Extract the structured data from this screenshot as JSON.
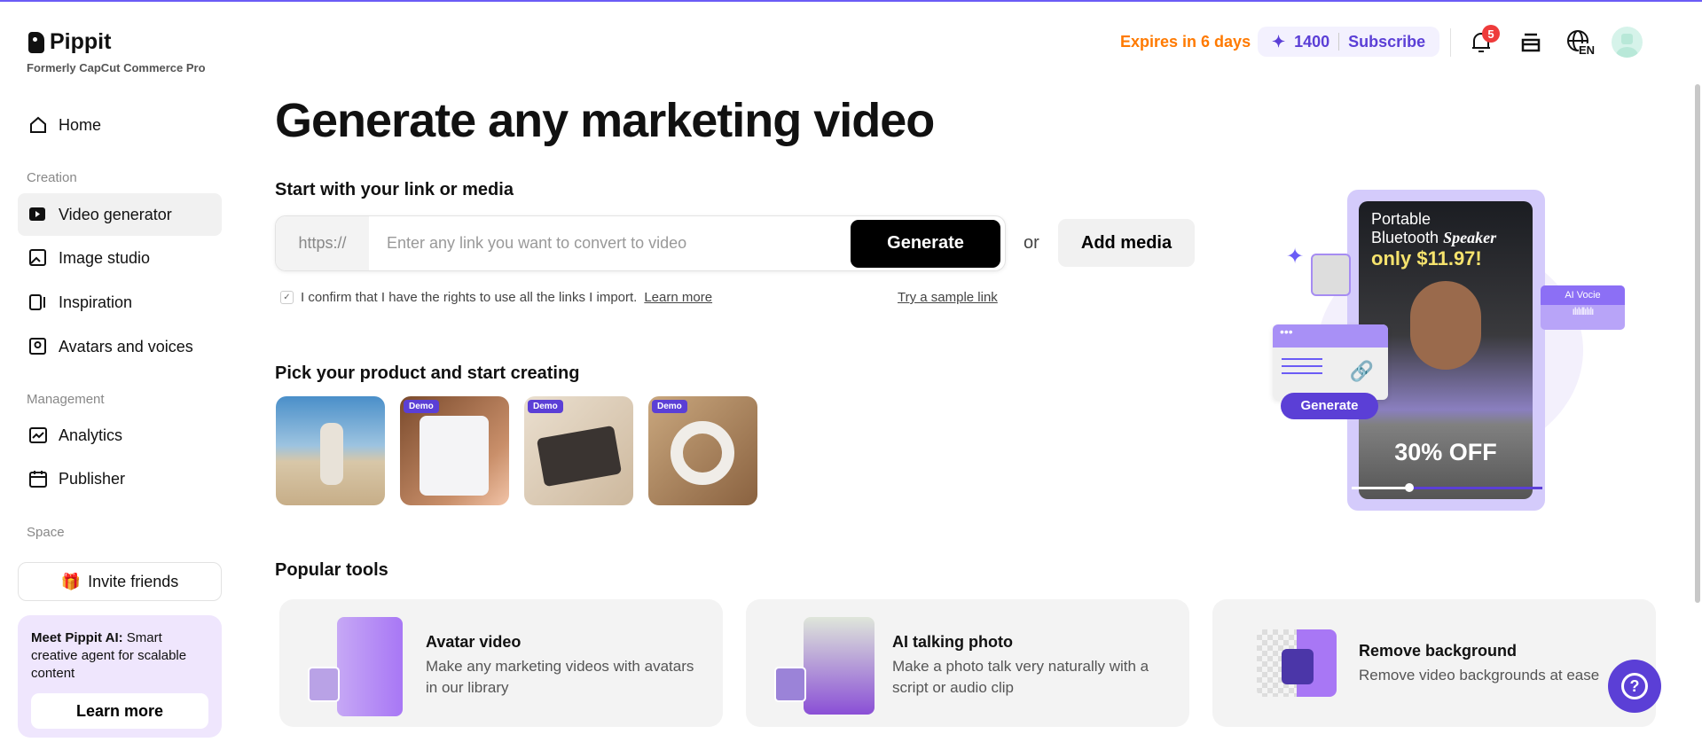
{
  "brand": {
    "name": "Pippit",
    "subtitle": "Formerly CapCut Commerce Pro"
  },
  "header": {
    "expires": "Expires in 6 days",
    "credits": "1400",
    "subscribe": "Subscribe",
    "notifications": "5",
    "language": "EN"
  },
  "sidebar": {
    "home": "Home",
    "creation_label": "Creation",
    "creation": [
      "Video generator",
      "Image studio",
      "Inspiration",
      "Avatars and voices"
    ],
    "management_label": "Management",
    "management": [
      "Analytics",
      "Publisher"
    ],
    "space_label": "Space",
    "invite": "Invite friends",
    "promo": {
      "bold": "Meet Pippit AI:",
      "text": " Smart creative agent for scalable content",
      "button": "Learn more"
    }
  },
  "main": {
    "title": "Generate any marketing video",
    "start_label": "Start with your link or media",
    "protocol": "https://",
    "placeholder": "Enter any link you want to convert to video",
    "generate": "Generate",
    "or": "or",
    "add_media": "Add media",
    "confirm": "I confirm that I have the rights to use all the links I import.",
    "learn_more": "Learn more",
    "sample": "Try a sample link",
    "pick_label": "Pick your product and start creating",
    "demo": "Demo",
    "popular_label": "Popular tools",
    "tools": [
      {
        "title": "Avatar video",
        "desc": "Make any marketing videos with avatars in our library"
      },
      {
        "title": "AI talking photo",
        "desc": "Make a photo talk very naturally with a script or audio clip"
      },
      {
        "title": "Remove background",
        "desc": "Remove video backgrounds at ease"
      }
    ]
  },
  "hero": {
    "line1": "Portable",
    "line2": "Bluetooth",
    "line2b": "Speaker",
    "price": "only $11.97!",
    "discount": "30% OFF",
    "ai_voice": "AI Vocie",
    "generate": "Generate"
  },
  "colors": {
    "accent": "#5b3fd6",
    "orange": "#ff7a00"
  }
}
